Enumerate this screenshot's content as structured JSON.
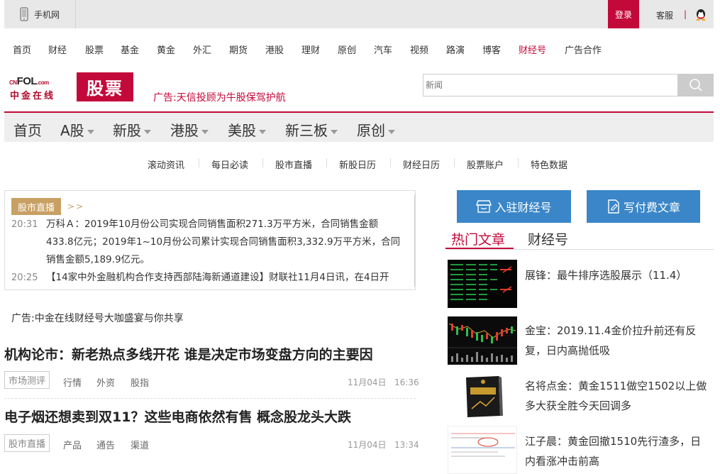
{
  "topbar": {
    "mobile_label": "手机网",
    "login_label": "登录",
    "service_label": "客服",
    "divider": "|"
  },
  "nav1": [
    "首页",
    "财经",
    "股票",
    "基金",
    "黄金",
    "外汇",
    "期货",
    "港股",
    "理财",
    "原创",
    "汽车",
    "视频",
    "路演",
    "博客",
    "财经号",
    "广告合作"
  ],
  "logo": {
    "line1_a": "CN",
    "line1_b": "FOL",
    "line1_c": ".com",
    "line2": "中金在线",
    "section": "股票"
  },
  "ad_top": "广告:天信投顾为牛股保驾护航",
  "search": {
    "placeholder": "新闻"
  },
  "nav2": [
    "首页",
    "A股",
    "新股",
    "港股",
    "美股",
    "新三板",
    "原创"
  ],
  "subnav": [
    "滚动资讯",
    "每日必读",
    "股市直播",
    "新股日历",
    "财经日历",
    "股票账户",
    "特色数据"
  ],
  "live": {
    "tag": "股市直播",
    "more": ">>",
    "items": [
      {
        "time": "20:31",
        "text": "万科Ａ：2019年10月份公司实现合同销售面积271.3万平方米，合同销售金额433.8亿元；2019年1~10月份公司累计实现合同销售面积3,332.9万平方米，合同销售金额5,189.9亿元。"
      },
      {
        "time": "20:25",
        "text": "【14家中外金融机构合作支持西部陆海新通道建设】财联社11月4日讯，在4日开"
      }
    ]
  },
  "ad_mid": "广告:中金在线财经号大咖盛宴与你共享",
  "articles": [
    {
      "title": "机构论市：新老热点多线开花 谁是决定市场变盘方向的主要因",
      "tag": "市场测评",
      "keywords": [
        "行情",
        "外资",
        "股指"
      ],
      "date": "11月04日",
      "time": "16:36"
    },
    {
      "title": "电子烟还想卖到双11？这些电商依然有售 概念股龙头大跌",
      "tag": "股市直播",
      "keywords": [
        "产品",
        "通告",
        "渠道"
      ],
      "date": "11月04日",
      "time": "13:34"
    }
  ],
  "buttons": {
    "join": "入驻财经号",
    "write": "写付费文章"
  },
  "tabs": [
    "热门文章",
    "财经号"
  ],
  "hot": [
    "展锋：最牛排序选股展示（11.4）",
    "金宝：2019.11.4金价拉升前还有反复，日内高抛低吸",
    "名将点金：黄金1511做空1502以上做多大获全胜今天回调多",
    "江子晨：黄金回撤1510先行渣多，日内看涨冲击前高"
  ],
  "colors": {
    "brand_red": "#c3093a",
    "gold": "#c8a064",
    "blue": "#3a86c8"
  }
}
